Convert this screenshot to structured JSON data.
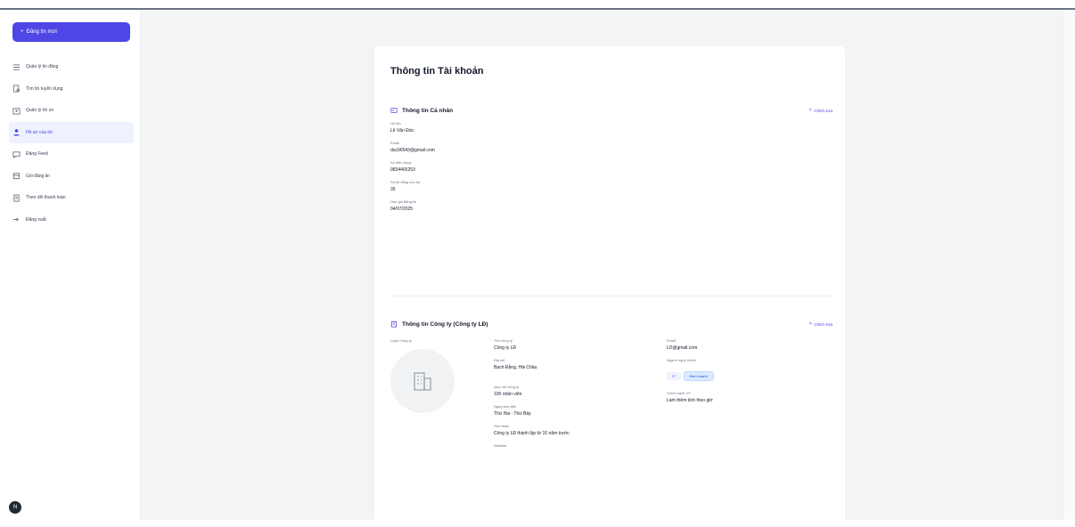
{
  "sidebar": {
    "create_label": "Đăng tin mới",
    "items": [
      {
        "label": "Quản lý tin đăng",
        "icon": "list-icon",
        "active": false
      },
      {
        "label": "Tìm tin tuyển dụng",
        "icon": "search-doc-icon",
        "active": false
      },
      {
        "label": "Quản lý hồ sơ",
        "icon": "folder-user-icon",
        "active": false
      },
      {
        "label": "Hồ sơ của tôi",
        "icon": "user-icon",
        "active": true
      },
      {
        "label": "Đăng Feed",
        "icon": "chat-icon",
        "active": false
      },
      {
        "label": "Gói đăng tin",
        "icon": "package-icon",
        "active": false
      },
      {
        "label": "Theo dõi thanh toán",
        "icon": "receipt-icon",
        "active": false
      },
      {
        "label": "Đăng xuất",
        "icon": "logout-icon",
        "active": false
      }
    ],
    "help_label": "N"
  },
  "card": {
    "title": "Thông tin Tài khoản",
    "personal": {
      "title": "Thông tin Cá nhân",
      "edit_label": "Chỉnh sửa",
      "fields": [
        {
          "label": "Họ tên",
          "value": "Lê Văn Đức"
        },
        {
          "label": "Email",
          "value": "duc96543@gmail.com"
        },
        {
          "label": "Số điện thoại",
          "value": "0834465253"
        },
        {
          "label": "Số tin đăng còn lại",
          "value": "35"
        },
        {
          "label": "Hạn gói đăng tin",
          "value": "04/07/2025"
        }
      ]
    },
    "company": {
      "title": "Thông tin Công ty (Công ty LĐ)",
      "edit_label": "Chỉnh sửa",
      "logo_label": "Logo Công ty",
      "col1": [
        {
          "label": "Tên công ty",
          "value": "Công ty LĐ"
        },
        {
          "label": "Địa chỉ",
          "value": "Bạch Đằng, Hải Châu"
        },
        {
          "label": "Quy mô công ty",
          "value": "100 nhân viên"
        },
        {
          "label": "Ngày làm việc",
          "value": "Thứ Hai - Thứ Bảy"
        },
        {
          "label": "Giới thiệu",
          "value": "Công ty LĐ thành lập từ 10 năm trước"
        },
        {
          "label": "Website",
          "value": ""
        }
      ],
      "col2": [
        {
          "label": "Email",
          "value": "LD@gmail.com"
        },
        {
          "label": "Ngành nghề chính",
          "value": ""
        },
        {
          "label": "Chính sách OT",
          "value": "Làm thêm tính theo giờ"
        }
      ],
      "chips": [
        "IT",
        "Kinh doanh"
      ]
    }
  }
}
